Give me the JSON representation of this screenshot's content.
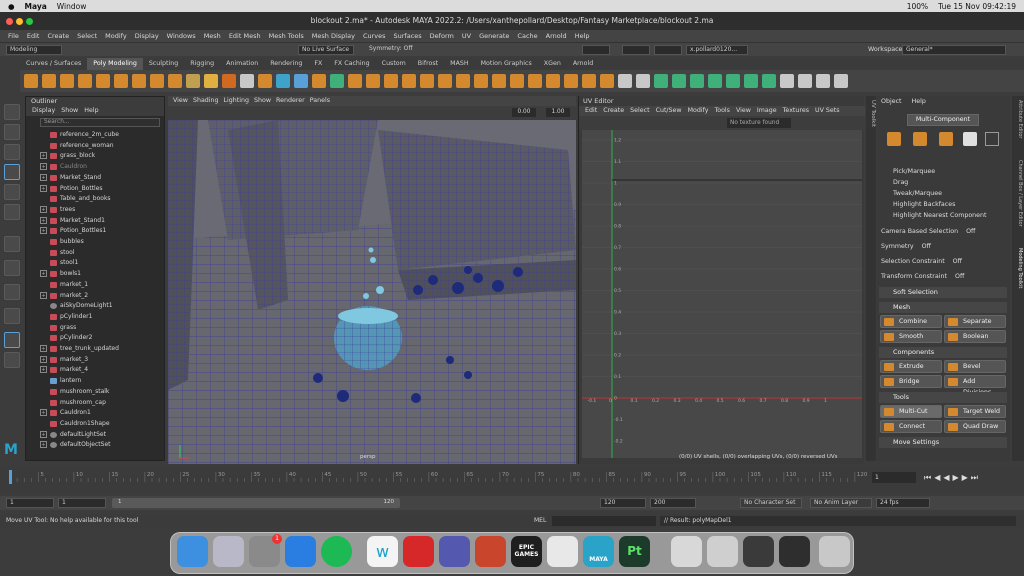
{
  "macmenu": {
    "app": "Maya",
    "items": [
      "Window"
    ],
    "date": "Tue 15 Nov  09:42:19",
    "battery": "100%"
  },
  "window": {
    "title": "blockout 2.ma* - Autodesk MAYA 2022.2: /Users/xanthepollard/Desktop/Fantasy Marketplace/blockout 2.ma"
  },
  "menubar": [
    "File",
    "Edit",
    "Create",
    "Select",
    "Modify",
    "Display",
    "Windows",
    "Mesh",
    "Edit Mesh",
    "Mesh Tools",
    "Mesh Display",
    "Curves",
    "Surfaces",
    "Deform",
    "UV",
    "Generate",
    "Cache",
    "Arnold",
    "Help"
  ],
  "workspace": {
    "label": "Workspace:",
    "value": "General*"
  },
  "statusline": {
    "mode": "Modeling",
    "live_surface": "No Live Surface",
    "symmetry": "Symmetry: Off",
    "x": "X",
    "y": "Y",
    "z": "Z",
    "user": "x.pollard0120..."
  },
  "shelf_tabs": [
    "Curves / Surfaces",
    "Poly Modeling",
    "Sculpting",
    "Rigging",
    "Animation",
    "Rendering",
    "FX",
    "FX Caching",
    "Custom",
    "Bifrost",
    "MASH",
    "Motion Graphics",
    "XGen",
    "Arnold"
  ],
  "shelf_active": "Poly Modeling",
  "outliner": {
    "title": "Outliner",
    "menu": [
      "Display",
      "Show",
      "Help"
    ],
    "search": "Search...",
    "items": [
      "reference_2m_cube",
      "reference_woman",
      "grass_block",
      "Cauldron",
      "Market_Stand",
      "Potion_Bottles",
      "Table_and_books",
      "trees",
      "Market_Stand1",
      "Potion_Bottles1",
      "bubbles",
      "stool",
      "stool1",
      "bowls1",
      "market_1",
      "market_2",
      "aiSkyDomeLight1",
      "pCylinder1",
      "grass",
      "pCylinder2",
      "tree_trunk_updated",
      "market_3",
      "market_4",
      "lantern",
      "mushroom_stalk",
      "mushroom_cap",
      "Cauldron1",
      "Cauldron1Shape",
      "defaultLightSet",
      "defaultObjectSet"
    ]
  },
  "viewport": {
    "menu": [
      "View",
      "Shading",
      "Lighting",
      "Show",
      "Renderer",
      "Panels"
    ],
    "camera": "persp",
    "field1": "0.00",
    "field2": "1.00"
  },
  "uv_editor": {
    "title": "UV Editor",
    "menu": [
      "Edit",
      "Create",
      "Select",
      "Cut/Sew",
      "Modify",
      "Tools",
      "View",
      "Image",
      "Textures",
      "UV Sets"
    ],
    "texture": "No texture found",
    "status": "(0/0) UV shells, (0/0) overlapping UVs, (0/0) reversed UVs",
    "hticks": [
      "-0.1",
      "0",
      "0.1",
      "0.2",
      "0.3",
      "0.4",
      "0.5",
      "0.6",
      "0.7",
      "0.8",
      "0.9",
      "1"
    ],
    "vticks": [
      "1.2",
      "1.1",
      "1",
      "0.9",
      "0.8",
      "0.7",
      "0.6",
      "0.5",
      "0.4",
      "0.3",
      "0.2",
      "0.1",
      "0",
      "-0.1",
      "-0.2"
    ]
  },
  "modeling_toolkit": {
    "menu": [
      "Object",
      "Help"
    ],
    "mode": "Multi-Component",
    "options": [
      "Pick/Marquee",
      "Drag",
      "Tweak/Marquee",
      "Highlight Backfaces",
      "Highlight Nearest Component"
    ],
    "camera_sel": "Camera Based Selection",
    "camera_sel_val": "Off",
    "symmetry": "Symmetry",
    "symmetry_val": "Off",
    "sel_constraint": "Selection Constraint",
    "sel_constraint_val": "Off",
    "transform_constraint": "Transform Constraint",
    "transform_constraint_val": "Off",
    "soft_selection": "Soft Selection",
    "sections": [
      "Mesh",
      "Components",
      "Tools",
      "Move Settings"
    ],
    "mesh_buttons": [
      "Combine",
      "Separate",
      "Smooth",
      "Boolean"
    ],
    "component_buttons": [
      "Extrude",
      "Bevel",
      "Bridge",
      "Add Divisions"
    ],
    "tool_buttons": [
      "Multi-Cut",
      "Target Weld",
      "Connect",
      "Quad Draw"
    ]
  },
  "side_tabs": [
    "UV Toolkit",
    "Attribute Editor",
    "Channel Box / Layer Editor",
    "Modeling Toolkit"
  ],
  "timeline": {
    "ticks": [
      "5",
      "10",
      "15",
      "20",
      "25",
      "30",
      "35",
      "40",
      "45",
      "50",
      "55",
      "60",
      "65",
      "70",
      "75",
      "80",
      "85",
      "90",
      "95",
      "100",
      "105",
      "110",
      "115",
      "120"
    ],
    "current": "1"
  },
  "range": {
    "start": "1",
    "start2": "1",
    "range_start": "1",
    "range_end": "120",
    "end1": "120",
    "end2": "200",
    "character_set": "No Character Set",
    "anim_layer": "No Anim Layer",
    "fps": "24 fps"
  },
  "command": {
    "lang": "MEL",
    "result": "// Result: polyMapDel1",
    "help": "Move UV Tool: No help available for this tool"
  },
  "dock": [
    "finder-icon",
    "launchpad-icon",
    "settings-icon",
    "safari-icon",
    "spotify-icon",
    "webex-icon",
    "acrobat-icon",
    "teams-icon",
    "powerpoint-icon",
    "epic-games-icon",
    "zbrush-icon",
    "maya-icon",
    "substance-painter-icon"
  ],
  "dock_epic": "EPIC GAMES",
  "dock_maya": "MAYA",
  "dock_pt": "Pt",
  "settings_badge": "1"
}
